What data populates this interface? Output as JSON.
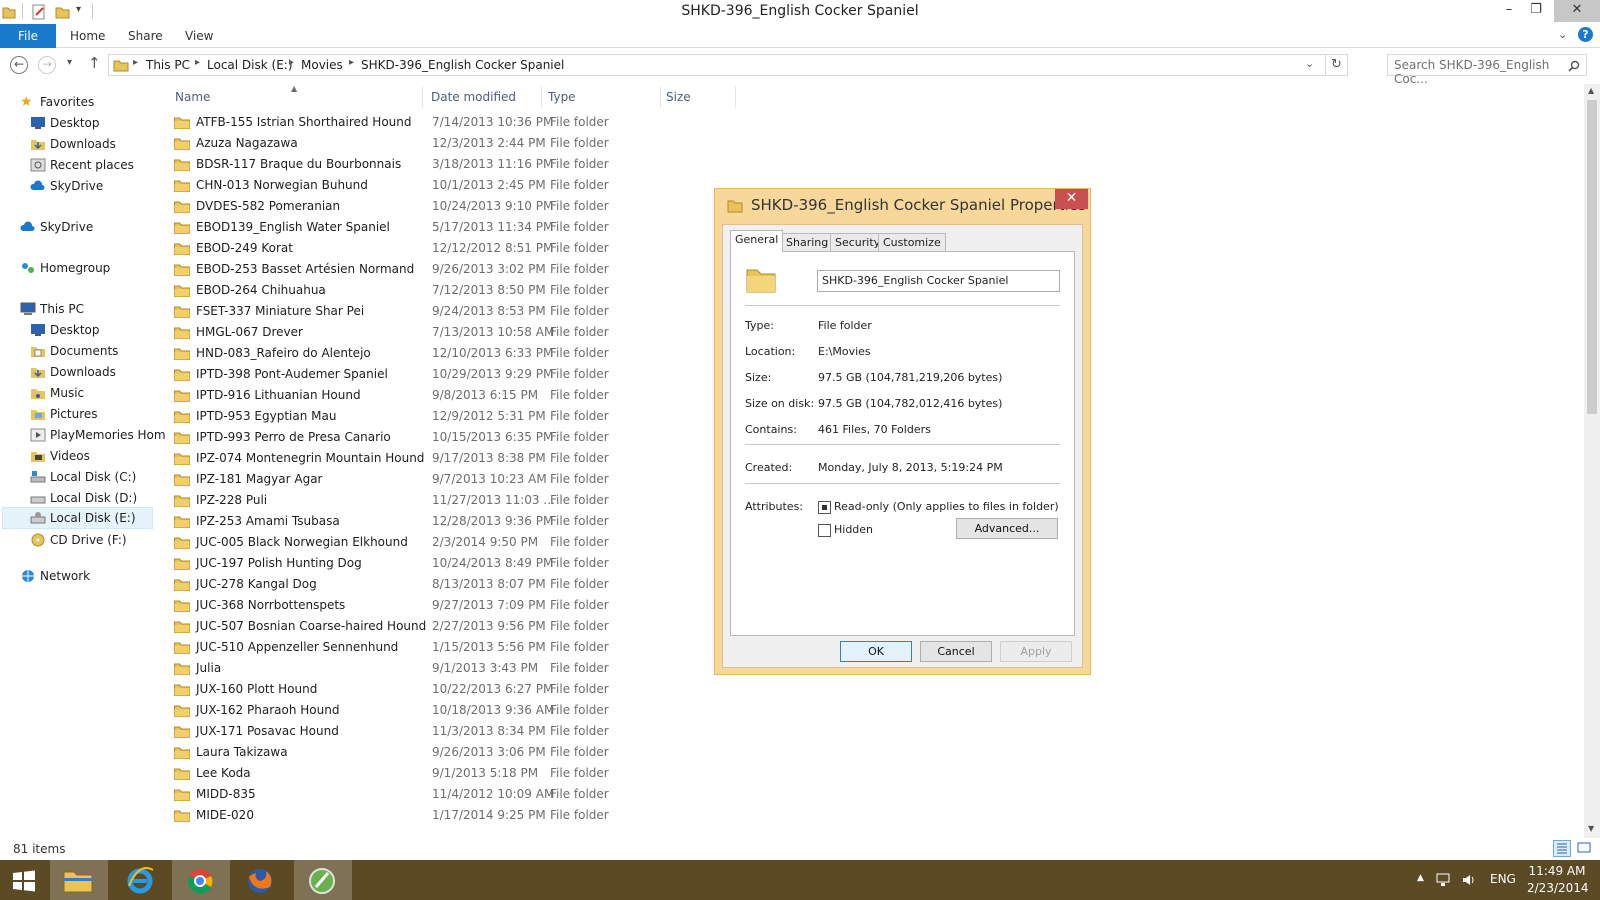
{
  "window": {
    "title": "SHKD-396_English Cocker Spaniel",
    "controls": [
      "–",
      "❐",
      "✕"
    ]
  },
  "ribbon": {
    "tabs": [
      "File",
      "Home",
      "Share",
      "View"
    ]
  },
  "address": {
    "crumbs": [
      "This PC",
      "Local Disk (E:)",
      "Movies",
      "SHKD-396_English Cocker Spaniel"
    ],
    "search_placeholder": "Search SHKD-396_English Coc..."
  },
  "nav": {
    "favorites": "Favorites",
    "fav_items": [
      "Desktop",
      "Downloads",
      "Recent places",
      "SkyDrive"
    ],
    "skydrive": "SkyDrive",
    "homegroup": "Homegroup",
    "thispc": "This PC",
    "pc_items": [
      "Desktop",
      "Documents",
      "Downloads",
      "Music",
      "Pictures",
      "PlayMemories Hom",
      "Videos",
      "Local Disk (C:)",
      "Local Disk (D:)",
      "Local Disk (E:)",
      "CD Drive (F:)"
    ],
    "network": "Network"
  },
  "columns": {
    "name": "Name",
    "date": "Date modified",
    "type": "Type",
    "size": "Size"
  },
  "files": [
    {
      "name": "ATFB-155 Istrian Shorthaired Hound",
      "date": "7/14/2013 10:36 PM",
      "type": "File folder"
    },
    {
      "name": "Azuza Nagazawa",
      "date": "12/3/2013 2:44 PM",
      "type": "File folder"
    },
    {
      "name": "BDSR-117 Braque du Bourbonnais",
      "date": "3/18/2013 11:16 PM",
      "type": "File folder"
    },
    {
      "name": "CHN-013 Norwegian Buhund",
      "date": "10/1/2013 2:45 PM",
      "type": "File folder"
    },
    {
      "name": "DVDES-582 Pomeranian",
      "date": "10/24/2013 9:10 PM",
      "type": "File folder"
    },
    {
      "name": "EBOD139_English Water Spaniel",
      "date": "5/17/2013 11:34 PM",
      "type": "File folder"
    },
    {
      "name": "EBOD-249 Korat",
      "date": "12/12/2012 8:51 PM",
      "type": "File folder"
    },
    {
      "name": "EBOD-253 Basset Artésien Normand",
      "date": "9/26/2013 3:02 PM",
      "type": "File folder"
    },
    {
      "name": "EBOD-264 Chihuahua",
      "date": "7/12/2013 8:50 PM",
      "type": "File folder"
    },
    {
      "name": "FSET-337 Miniature Shar Pei",
      "date": "9/24/2013 8:53 PM",
      "type": "File folder"
    },
    {
      "name": "HMGL-067 Drever",
      "date": "7/13/2013 10:58 AM",
      "type": "File folder"
    },
    {
      "name": "HND-083_Rafeiro do Alentejo",
      "date": "12/10/2013 6:33 PM",
      "type": "File folder"
    },
    {
      "name": "IPTD-398 Pont-Audemer Spaniel",
      "date": "10/29/2013 9:29 PM",
      "type": "File folder"
    },
    {
      "name": "IPTD-916 Lithuanian Hound",
      "date": "9/8/2013 6:15 PM",
      "type": "File folder"
    },
    {
      "name": "IPTD-953 Egyptian Mau",
      "date": "12/9/2012 5:31 PM",
      "type": "File folder"
    },
    {
      "name": "IPTD-993 Perro de Presa Canario",
      "date": "10/15/2013 6:35 PM",
      "type": "File folder"
    },
    {
      "name": "IPZ-074 Montenegrin Mountain Hound",
      "date": "9/17/2013 8:38 PM",
      "type": "File folder"
    },
    {
      "name": "IPZ-181 Magyar Agar",
      "date": "9/7/2013 10:23 AM",
      "type": "File folder"
    },
    {
      "name": "IPZ-228 Puli",
      "date": "11/27/2013 11:03 ...",
      "type": "File folder"
    },
    {
      "name": "IPZ-253 Amami Tsubasa",
      "date": "12/28/2013 9:36 PM",
      "type": "File folder"
    },
    {
      "name": "JUC-005 Black Norwegian Elkhound",
      "date": "2/3/2014 9:50 PM",
      "type": "File folder"
    },
    {
      "name": "JUC-197 Polish Hunting Dog",
      "date": "10/24/2013 8:49 PM",
      "type": "File folder"
    },
    {
      "name": "JUC-278 Kangal Dog",
      "date": "8/13/2013 8:07 PM",
      "type": "File folder"
    },
    {
      "name": "JUC-368 Norrbottenspets",
      "date": "9/27/2013 7:09 PM",
      "type": "File folder"
    },
    {
      "name": "JUC-507 Bosnian Coarse-haired Hound",
      "date": "2/27/2013 9:56 PM",
      "type": "File folder"
    },
    {
      "name": "JUC-510 Appenzeller Sennenhund",
      "date": "1/15/2013 5:56 PM",
      "type": "File folder"
    },
    {
      "name": "Julia",
      "date": "9/1/2013 3:43 PM",
      "type": "File folder"
    },
    {
      "name": "JUX-160 Plott Hound",
      "date": "10/22/2013 6:27 PM",
      "type": "File folder"
    },
    {
      "name": "JUX-162 Pharaoh Hound",
      "date": "10/18/2013 9:36 AM",
      "type": "File folder"
    },
    {
      "name": "JUX-171 Posavac Hound",
      "date": "11/3/2013 8:34 PM",
      "type": "File folder"
    },
    {
      "name": "Laura Takizawa",
      "date": "9/26/2013 3:06 PM",
      "type": "File folder"
    },
    {
      "name": "Lee Koda",
      "date": "9/1/2013 5:18 PM",
      "type": "File folder"
    },
    {
      "name": "MIDD-835",
      "date": "11/4/2012 10:09 AM",
      "type": "File folder"
    },
    {
      "name": "MIDE-020",
      "date": "1/17/2014 9:25 PM",
      "type": "File folder"
    }
  ],
  "status": {
    "count": "81 items"
  },
  "dialog": {
    "title": "SHKD-396_English Cocker Spaniel Properties",
    "tabs": [
      "General",
      "Sharing",
      "Security",
      "Customize"
    ],
    "name_value": "SHKD-396_English Cocker Spaniel",
    "labels": {
      "type": "Type:",
      "location": "Location:",
      "size": "Size:",
      "size_on_disk": "Size on disk:",
      "contains": "Contains:",
      "created": "Created:",
      "attributes": "Attributes:"
    },
    "values": {
      "type": "File folder",
      "location": "E:\\Movies",
      "size": "97.5 GB (104,781,219,206 bytes)",
      "size_on_disk": "97.5 GB (104,782,012,416 bytes)",
      "contains": "461 Files, 70 Folders",
      "created": "Monday, July 8, 2013, 5:19:24 PM"
    },
    "readonly_label": "Read-only (Only applies to files in folder)",
    "hidden_label": "Hidden",
    "advanced_label": "Advanced...",
    "ok_label": "OK",
    "cancel_label": "Cancel",
    "apply_label": "Apply"
  },
  "tray": {
    "lang": "ENG",
    "time": "11:49 AM",
    "date": "2/23/2014"
  },
  "colors": {
    "accent": "#1979ca",
    "taskbar": "#5c4a25",
    "dialog_frame": "#f8d89a",
    "close_red": "#c75050"
  }
}
